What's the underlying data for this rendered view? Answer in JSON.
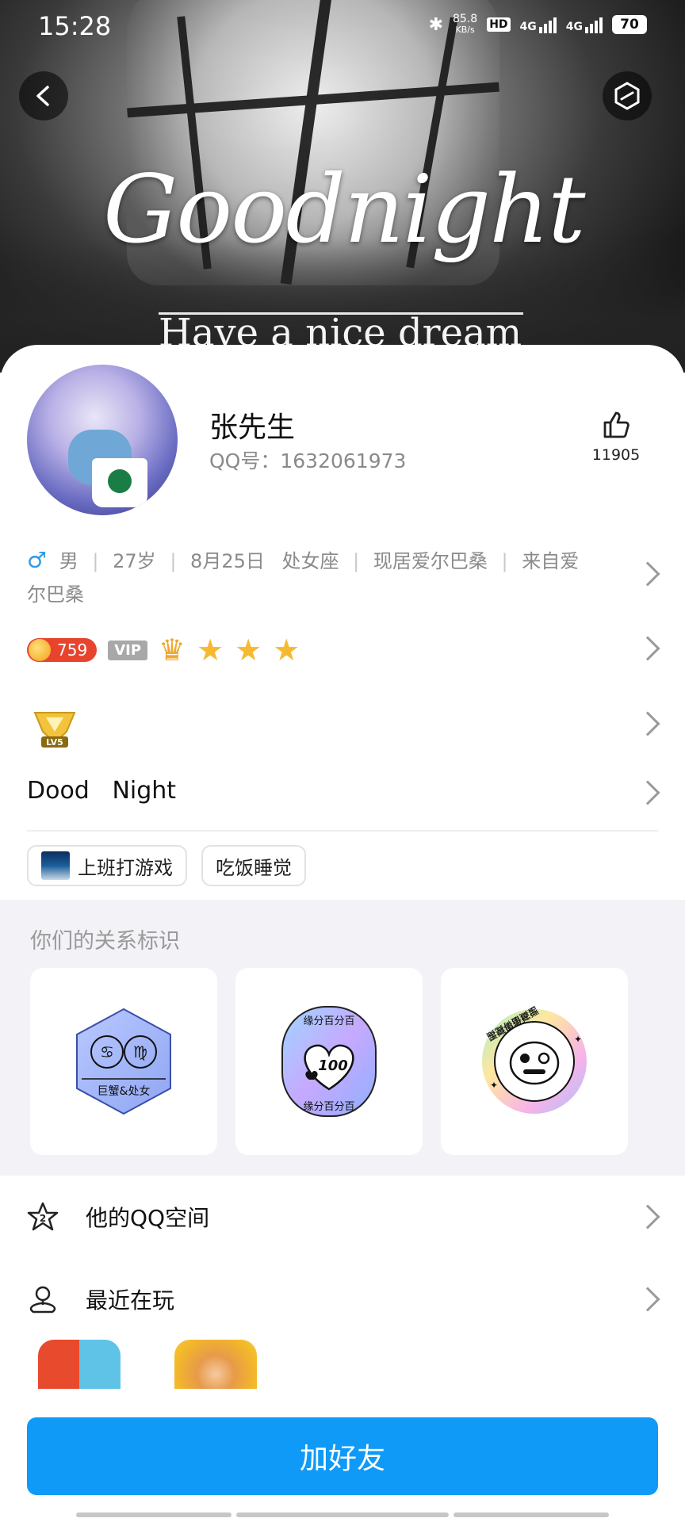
{
  "status_bar": {
    "time": "15:28",
    "net_speed_value": "85.8",
    "net_speed_unit": "KB/s",
    "hd": "HD",
    "net1": "4G",
    "net2": "4G",
    "battery": "70"
  },
  "banner": {
    "title": "Goodnight",
    "subtitle": "Have a nice dream"
  },
  "profile": {
    "name": "张先生",
    "qq": "QQ号：1632061973",
    "likes": "11905",
    "info": {
      "gender": "男",
      "age": "27岁",
      "birthday": "8月25日",
      "zodiac": "处女座",
      "residence": "现居爱尔巴桑",
      "from": "来自爱尔巴桑"
    },
    "coins": "759",
    "vip_label": "VIP",
    "level_label": "LV5",
    "signature": "Dood   Night",
    "tags": [
      "上班打游戏",
      "吃饭睡觉"
    ]
  },
  "relations": {
    "title": "你们的关系标识",
    "badges": [
      {
        "name": "巨蟹&处女",
        "top": "",
        "bottom": ""
      },
      {
        "name": "100",
        "top": "缘分百分百",
        "bottom": "缘分百分百"
      },
      {
        "name": "",
        "top": "宝藏值得挖掘",
        "bottom": "宝藏值得挖掘"
      }
    ]
  },
  "menu": {
    "qzone": "他的QQ空间",
    "recent": "最近在玩"
  },
  "actions": {
    "add_friend": "加好友"
  },
  "colors": {
    "primary": "#0f9af7",
    "male": "#2f9be8",
    "coin_bg": "#e8442d"
  }
}
